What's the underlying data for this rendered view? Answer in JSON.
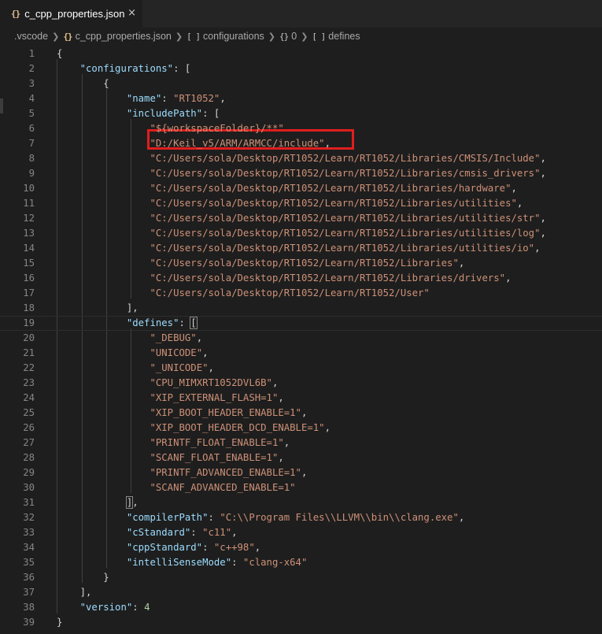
{
  "tab": {
    "icon": "{}",
    "title": "c_cpp_properties.json",
    "close": "×",
    "close_icon": "close-icon",
    "file_icon": "json-file-icon"
  },
  "breadcrumb": [
    {
      "icon": "",
      "label": ".vscode"
    },
    {
      "icon": "{}",
      "label": "c_cpp_properties.json"
    },
    {
      "icon": "[ ]",
      "label": "configurations"
    },
    {
      "icon": "{}",
      "label": "0"
    },
    {
      "icon": "[ ]",
      "label": "defines"
    }
  ],
  "colors": {
    "background": "#1e1e1e",
    "key": "#9cdcfe",
    "string": "#ce9178",
    "number": "#b5cea8",
    "punctuation": "#d4d4d4",
    "line_number": "#858585",
    "highlight_box": "#e01e1e"
  },
  "editor": {
    "lines": [
      {
        "n": "1",
        "code": "{"
      },
      {
        "n": "2",
        "code": "    \"configurations\": ["
      },
      {
        "n": "3",
        "code": "        {"
      },
      {
        "n": "4",
        "code": "            \"name\": \"RT1052\","
      },
      {
        "n": "5",
        "code": "            \"includePath\": ["
      },
      {
        "n": "6",
        "code": "                \"${workspaceFolder}/**\""
      },
      {
        "n": "7",
        "code": "                \"D:/Keil_v5/ARM/ARMCC/include\","
      },
      {
        "n": "8",
        "code": "                \"C:/Users/sola/Desktop/RT1052/Learn/RT1052/Libraries/CMSIS/Include\","
      },
      {
        "n": "9",
        "code": "                \"C:/Users/sola/Desktop/RT1052/Learn/RT1052/Libraries/cmsis_drivers\","
      },
      {
        "n": "10",
        "code": "                \"C:/Users/sola/Desktop/RT1052/Learn/RT1052/Libraries/hardware\","
      },
      {
        "n": "11",
        "code": "                \"C:/Users/sola/Desktop/RT1052/Learn/RT1052/Libraries/utilities\","
      },
      {
        "n": "12",
        "code": "                \"C:/Users/sola/Desktop/RT1052/Learn/RT1052/Libraries/utilities/str\","
      },
      {
        "n": "13",
        "code": "                \"C:/Users/sola/Desktop/RT1052/Learn/RT1052/Libraries/utilities/log\","
      },
      {
        "n": "14",
        "code": "                \"C:/Users/sola/Desktop/RT1052/Learn/RT1052/Libraries/utilities/io\","
      },
      {
        "n": "15",
        "code": "                \"C:/Users/sola/Desktop/RT1052/Learn/RT1052/Libraries\","
      },
      {
        "n": "16",
        "code": "                \"C:/Users/sola/Desktop/RT1052/Learn/RT1052/Libraries/drivers\","
      },
      {
        "n": "17",
        "code": "                \"C:/Users/sola/Desktop/RT1052/Learn/RT1052/User\""
      },
      {
        "n": "18",
        "code": "            ],"
      },
      {
        "n": "19",
        "code": "            \"defines\": ["
      },
      {
        "n": "20",
        "code": "                \"_DEBUG\","
      },
      {
        "n": "21",
        "code": "                \"UNICODE\","
      },
      {
        "n": "22",
        "code": "                \"_UNICODE\","
      },
      {
        "n": "23",
        "code": "                \"CPU_MIMXRT1052DVL6B\","
      },
      {
        "n": "24",
        "code": "                \"XIP_EXTERNAL_FLASH=1\","
      },
      {
        "n": "25",
        "code": "                \"XIP_BOOT_HEADER_ENABLE=1\","
      },
      {
        "n": "26",
        "code": "                \"XIP_BOOT_HEADER_DCD_ENABLE=1\","
      },
      {
        "n": "27",
        "code": "                \"PRINTF_FLOAT_ENABLE=1\","
      },
      {
        "n": "28",
        "code": "                \"SCANF_FLOAT_ENABLE=1\","
      },
      {
        "n": "29",
        "code": "                \"PRINTF_ADVANCED_ENABLE=1\","
      },
      {
        "n": "30",
        "code": "                \"SCANF_ADVANCED_ENABLE=1\""
      },
      {
        "n": "31",
        "code": "            ],"
      },
      {
        "n": "32",
        "code": "            \"compilerPath\": \"C:\\\\Program Files\\\\LLVM\\\\bin\\\\clang.exe\","
      },
      {
        "n": "33",
        "code": "            \"cStandard\": \"c11\","
      },
      {
        "n": "34",
        "code": "            \"cppStandard\": \"c++98\","
      },
      {
        "n": "35",
        "code": "            \"intelliSenseMode\": \"clang-x64\""
      },
      {
        "n": "36",
        "code": "        }"
      },
      {
        "n": "37",
        "code": "    ],"
      },
      {
        "n": "38",
        "code": "    \"version\": 4"
      },
      {
        "n": "39",
        "code": "}"
      }
    ]
  }
}
